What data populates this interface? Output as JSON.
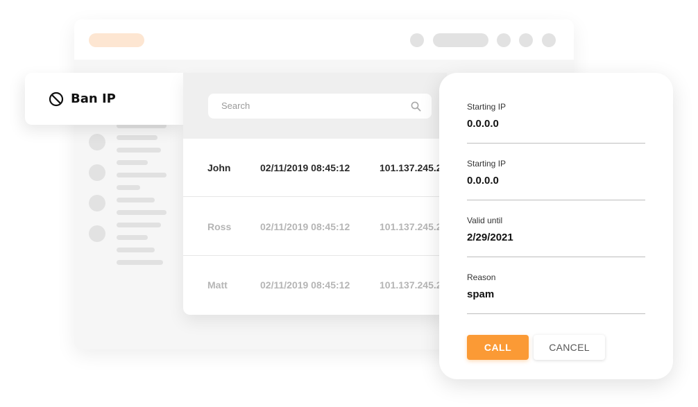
{
  "tab": {
    "label": "Ban IP",
    "icon": "ban-icon"
  },
  "search": {
    "placeholder": "Search",
    "icon": "search-icon"
  },
  "table": {
    "rows": [
      {
        "name": "John",
        "date": "02/11/2019 08:45:12",
        "ip": "101.137.245.2",
        "state": "active"
      },
      {
        "name": "Ross",
        "date": "02/11/2019 08:45:12",
        "ip": "101.137.245.2",
        "state": "dim"
      },
      {
        "name": "Matt",
        "date": "02/11/2019 08:45:12",
        "ip": "101.137.245.2",
        "state": "dim"
      }
    ]
  },
  "form": {
    "fields": [
      {
        "label": "Starting IP",
        "value": "0.0.0.0"
      },
      {
        "label": "Starting IP",
        "value": "0.0.0.0"
      },
      {
        "label": "Valid until",
        "value": "2/29/2021"
      },
      {
        "label": "Reason",
        "value": "spam"
      }
    ],
    "call_label": "CALL",
    "cancel_label": "CANCEL"
  },
  "colors": {
    "accent": "#fb9a35",
    "accent_light": "#fde6d2",
    "placeholder_gray": "#e1e1e1"
  }
}
